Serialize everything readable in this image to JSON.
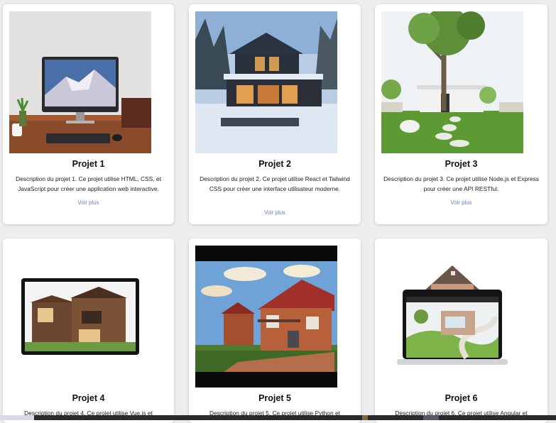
{
  "projects": [
    {
      "title": "Projet 1",
      "description": "Description du projet 1. Ce projet utilise HTML, CSS, et JavaScript pour créer une application web interactive.",
      "link": "Voir plus"
    },
    {
      "title": "Projet 2",
      "description": "Description du projet 2. Ce projet utilise React et Tailwind CSS pour créer une interface utilisateur moderne.",
      "link": "Voir plus"
    },
    {
      "title": "Projet 3",
      "description": "Description du projet 3. Ce projet utilise Node.js et Express pour créer une API RESTful.",
      "link": "Voir plus"
    },
    {
      "title": "Projet 4",
      "description": "Description du projet 4. Ce projet utilise Vue.js et"
    },
    {
      "title": "Projet 5",
      "description": "Description du projet 5. Ce projet utilise Python et"
    },
    {
      "title": "Projet 6",
      "description": "Description du projet 6. Ce projet utilise Angular et"
    }
  ],
  "images": [
    {
      "icon": "desktop-computer-image"
    },
    {
      "icon": "snowy-house-image"
    },
    {
      "icon": "garden-tree-image"
    },
    {
      "icon": "wooden-house-tablet-image"
    },
    {
      "icon": "brick-houses-image"
    },
    {
      "icon": "house-laptop-image"
    }
  ],
  "colors": {
    "link": "#6b7fc9",
    "background": "#eeeef0",
    "card": "#ffffff"
  }
}
